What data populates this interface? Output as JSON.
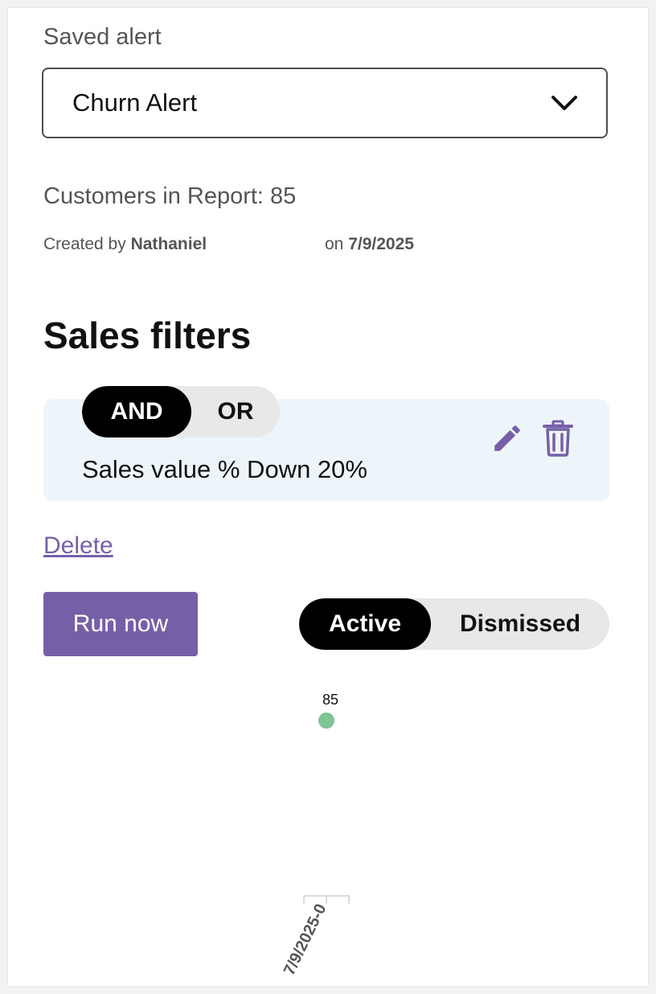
{
  "form": {
    "saved_alert_label": "Saved alert",
    "saved_alert_value": "Churn Alert",
    "customers_label": "Customers in Report: 85",
    "created_by_prefix": "Created by",
    "created_by_name": "Nathaniel",
    "created_on_prefix": "on",
    "created_on_date": "7/9/2025"
  },
  "filters": {
    "section_title": "Sales filters",
    "logic_options": [
      "AND",
      "OR"
    ],
    "logic_selected": "AND",
    "filter_text": "Sales value % Down 20%"
  },
  "actions": {
    "delete_label": "Delete",
    "run_label": "Run now",
    "status_options": [
      "Active",
      "Dismissed"
    ],
    "status_selected": "Active"
  },
  "colors": {
    "accent": "#7560a8",
    "point": "#7fc495",
    "toggle_on": "#000000",
    "toggle_off": "#e8e8e8",
    "filter_card": "#eef5fa"
  },
  "icons": {
    "dropdown": "chevron-down-icon",
    "edit": "pencil-icon",
    "delete": "trash-icon"
  },
  "chart_data": {
    "type": "scatter",
    "categories": [
      "7/9/2025-0"
    ],
    "values": [
      85
    ],
    "data_labels": [
      "85"
    ],
    "grid": false
  }
}
